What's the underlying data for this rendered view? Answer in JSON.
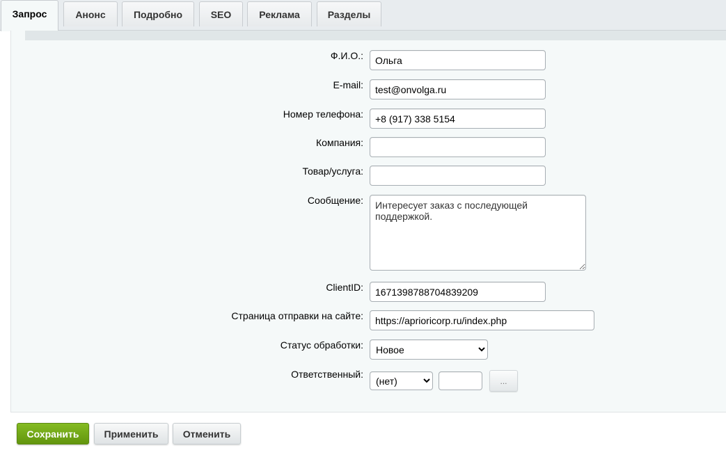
{
  "tabs": [
    {
      "label": "Запрос",
      "active": true
    },
    {
      "label": "Анонс"
    },
    {
      "label": "Подробно"
    },
    {
      "label": "SEO"
    },
    {
      "label": "Реклама"
    },
    {
      "label": "Разделы"
    }
  ],
  "form": {
    "fio": {
      "label": "Ф.И.О.:",
      "value": "Ольга"
    },
    "email": {
      "label": "E-mail:",
      "value": "test@onvolga.ru"
    },
    "phone": {
      "label": "Номер телефона:",
      "value": "+8 (917) 338 5154"
    },
    "company": {
      "label": "Компания:",
      "value": ""
    },
    "product": {
      "label": "Товар/услуга:",
      "value": ""
    },
    "message": {
      "label": "Сообщение:",
      "value": "Интересует заказ с последующей\nподдержкой."
    },
    "client_id": {
      "label": "ClientID:",
      "value": "1671398788704839209"
    },
    "page": {
      "label": "Страница отправки на сайте:",
      "value": "https://aprioricorp.ru/index.php"
    },
    "status": {
      "label": "Статус обработки:",
      "selected": "Новое"
    },
    "responsible": {
      "label": "Ответственный:",
      "selected": "(нет)",
      "id_value": "",
      "browse_label": "..."
    }
  },
  "footer": {
    "save": "Сохранить",
    "apply": "Применить",
    "cancel": "Отменить"
  },
  "colors": {
    "panel_bg": "#f5f9f9",
    "primary_button": "#72a918"
  }
}
